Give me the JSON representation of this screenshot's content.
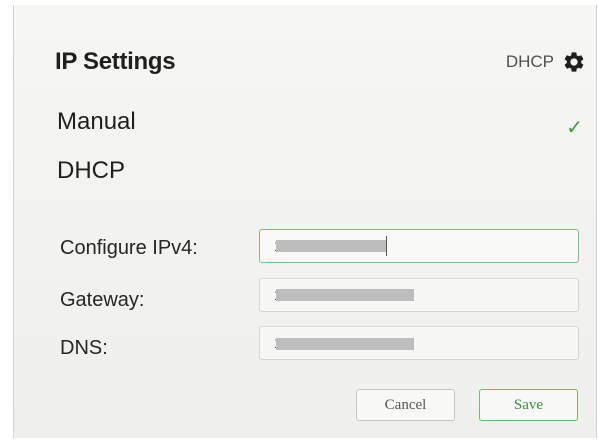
{
  "dialog": {
    "title": "IP Settings",
    "current_mode": "DHCP"
  },
  "modes": {
    "manual_label": "Manual",
    "dhcp_label": "DHCP",
    "selected": "Manual"
  },
  "fields": {
    "ipv4": {
      "label": "Configure IPv4:",
      "value": "1"
    },
    "gateway": {
      "label": "Gateway:",
      "value": "1"
    },
    "dns": {
      "label": "DNS:",
      "value": "1"
    }
  },
  "buttons": {
    "cancel_label": "Cancel",
    "save_label": "Save"
  },
  "colors": {
    "accent_green": "#3f9a43",
    "active_border": "#7cbc7c"
  },
  "icons": {
    "settings": "gear-icon",
    "selected_mark": "check-icon"
  }
}
